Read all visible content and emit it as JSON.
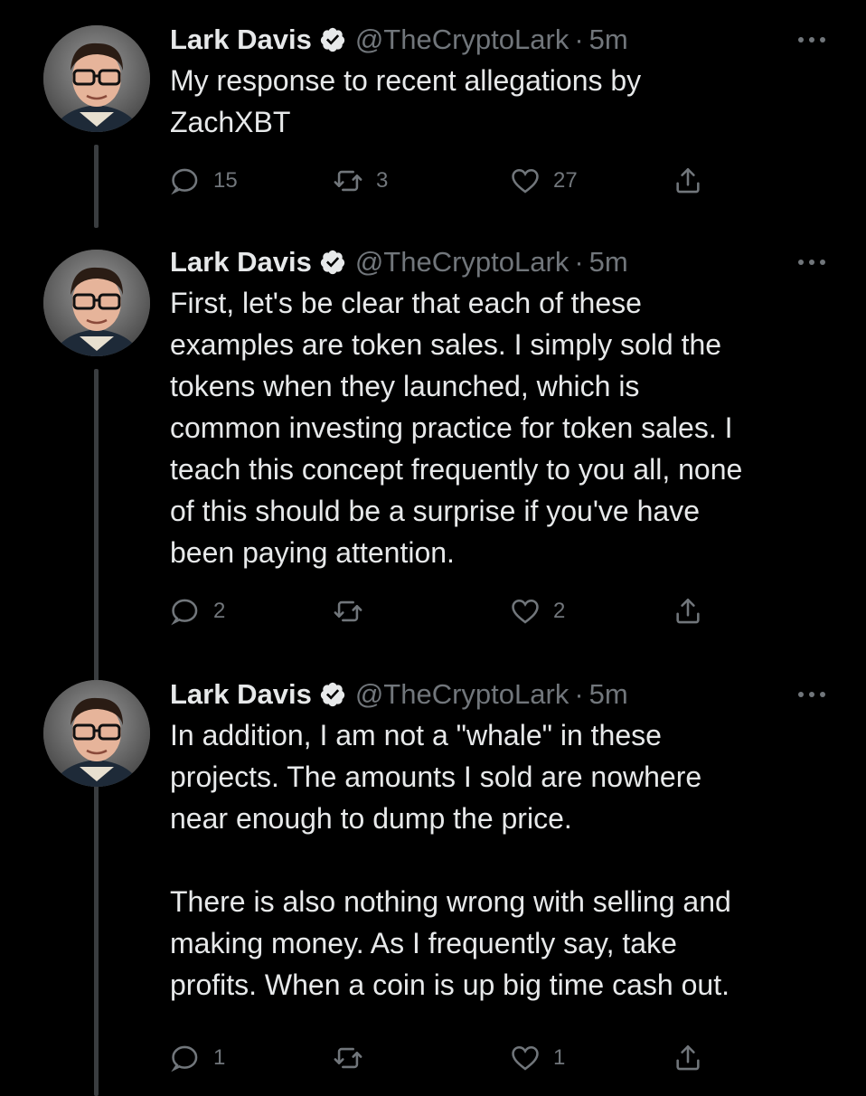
{
  "colors": {
    "background": "#000000",
    "primary_text": "#e7e9ea",
    "secondary_text": "#71767b",
    "thread_line": "#3a3d40"
  },
  "icons": {
    "verified": "verified-badge-icon",
    "more": "more-options-icon",
    "reply": "reply-icon",
    "retweet": "retweet-icon",
    "like": "heart-icon",
    "share": "share-icon"
  },
  "tweets": [
    {
      "display_name": "Lark Davis",
      "handle": "@TheCryptoLark",
      "separator": "·",
      "time": "5m",
      "text": "My response to recent allegations by\nZachXBT",
      "replies": "15",
      "retweets": "3",
      "likes": "27"
    },
    {
      "display_name": "Lark Davis",
      "handle": "@TheCryptoLark",
      "separator": "·",
      "time": "5m",
      "text": "First, let's be clear that each of these\nexamples are token sales. I simply sold the\ntokens when they launched, which is\ncommon investing practice for token sales. I\nteach this concept frequently to you all, none\nof this should be a surprise if you've have\nbeen paying attention.",
      "replies": "2",
      "retweets": "",
      "likes": "2"
    },
    {
      "display_name": "Lark Davis",
      "handle": "@TheCryptoLark",
      "separator": "·",
      "time": "5m",
      "text": "In addition, I am not a \"whale\" in these\nprojects. The amounts I sold are nowhere\nnear enough to dump the price.\n\nThere is also nothing wrong with selling and\nmaking money. As I frequently say, take\nprofits. When a coin is up big time cash out.",
      "replies": "1",
      "retweets": "",
      "likes": "1"
    }
  ]
}
